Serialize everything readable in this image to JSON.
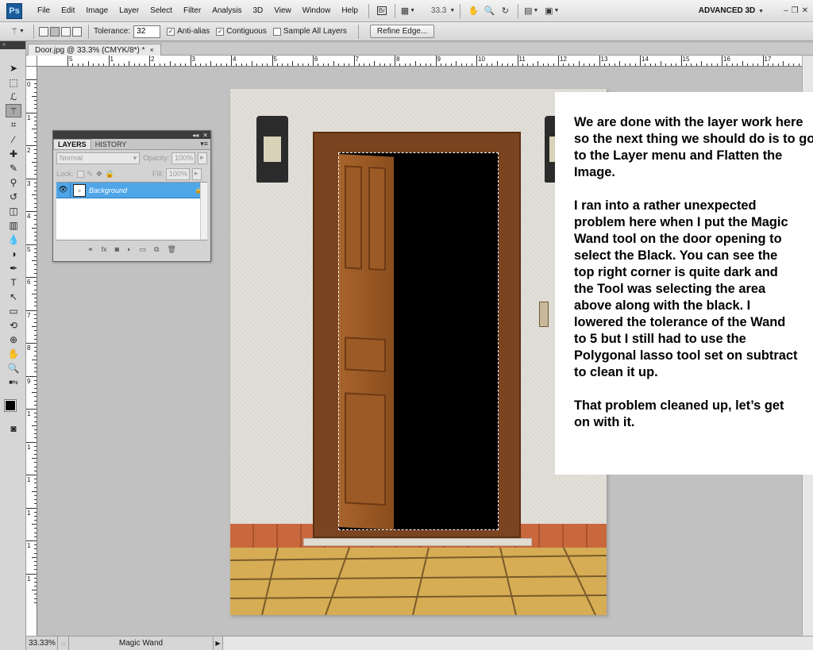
{
  "menubar": {
    "logo": "Ps",
    "items": [
      "File",
      "Edit",
      "Image",
      "Layer",
      "Select",
      "Filter",
      "Analysis",
      "3D",
      "View",
      "Window",
      "Help"
    ],
    "zoom": "33.3",
    "workspace": "ADVANCED 3D"
  },
  "options": {
    "tolerance_label": "Tolerance:",
    "tolerance_value": "32",
    "antialias_label": "Anti-alias",
    "antialias_checked": true,
    "contiguous_label": "Contiguous",
    "contiguous_checked": true,
    "sample_all_label": "Sample All Layers",
    "sample_all_checked": false,
    "refine_label": "Refine Edge..."
  },
  "document": {
    "tab_title": "Door.jpg @ 33.3% (CMYK/8*) *",
    "close": "×"
  },
  "rulers": {
    "h_labels": [
      "5",
      "1",
      "2",
      "3",
      "4",
      "5",
      "6",
      "7",
      "8",
      "9",
      "10",
      "11",
      "12",
      "13",
      "14",
      "15",
      "16",
      "17"
    ],
    "v_labels": [
      "0",
      "1",
      "2",
      "3",
      "4",
      "5",
      "6",
      "7",
      "8",
      "9",
      "1",
      "1",
      "1",
      "1",
      "1",
      "1"
    ]
  },
  "layers_panel": {
    "tabs": [
      "LAYERS",
      "HISTORY"
    ],
    "blend_mode": "Normal",
    "opacity_label": "Opacity:",
    "opacity_value": "100%",
    "lock_label": "Lock:",
    "fill_label": "Fill:",
    "fill_value": "100%",
    "layer_name": "Background",
    "colors": {
      "selected_row": "#4ea6e8"
    }
  },
  "note": {
    "paragraphs": [
      "We are done with the layer work here so the next thing we should do is to go to the Layer menu and Flatten the Image.",
      "I ran into a rather unexpected problem here when I put the Magic Wand tool on the door opening to select the Black.  You can see the top right corner is quite dark and the Tool was selecting the area above along with the black.  I lowered the tolerance of the Wand to 5 but I still had to use the Polygonal lasso tool set on subtract to clean it up.",
      "That problem cleaned up, let’s get on with it."
    ]
  },
  "status": {
    "zoom": "33.33%",
    "info": "Magic Wand"
  }
}
